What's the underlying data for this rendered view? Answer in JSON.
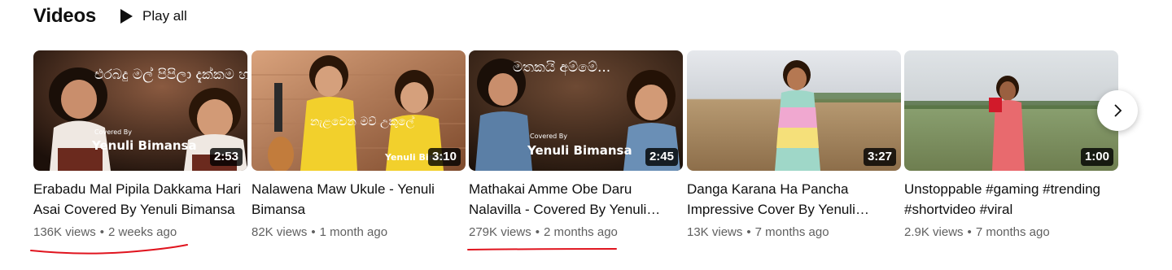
{
  "section": {
    "title": "Videos",
    "play_all_label": "Play all"
  },
  "videos": [
    {
      "title": "Erabadu Mal Pipila Dakkama Hari Asai Covered By Yenuli Bimansa",
      "duration": "2:53",
      "views": "136K views",
      "age": "2 weeks ago",
      "thumb_caption_small": "Covered By",
      "thumb_caption": "Yenuli Bimansa",
      "thumb_sinhala": "එරබදු මල් පිපිලා දැක්කම හරි ආසයි"
    },
    {
      "title": "Nalawena Maw Ukule - Yenuli Bimansa",
      "duration": "3:10",
      "views": "82K views",
      "age": "1 month ago",
      "thumb_caption_small": "",
      "thumb_caption": "Yenuli Bima",
      "thumb_sinhala": "නැළවෙන මව් උකුලේ"
    },
    {
      "title": "Mathakai Amme Obe Daru Nalavilla - Covered By Yenuli Bimansa",
      "duration": "2:45",
      "views": "279K views",
      "age": "2 months ago",
      "thumb_caption_small": "Covered By",
      "thumb_caption": "Yenuli Bimansa",
      "thumb_sinhala": "මතකයි අම්මේ..."
    },
    {
      "title": "Danga Karana Ha Pancha Impressive Cover By Yenuli Bimansa",
      "duration": "3:27",
      "views": "13K views",
      "age": "7 months ago",
      "thumb_caption_small": "",
      "thumb_caption": "",
      "thumb_sinhala": ""
    },
    {
      "title": "Unstoppable #gaming #trending #shortvideo #viral",
      "duration": "1:00",
      "views": "2.9K views",
      "age": "7 months ago",
      "thumb_caption_small": "",
      "thumb_caption": "",
      "thumb_sinhala": ""
    }
  ],
  "meta_separator": "•",
  "colors": {
    "annotation_red": "#e0141e",
    "meta_gray": "#606060",
    "duration_bg": "#000000"
  },
  "icons": {
    "play_all": "play-triangle-icon",
    "next": "chevron-right-icon"
  }
}
